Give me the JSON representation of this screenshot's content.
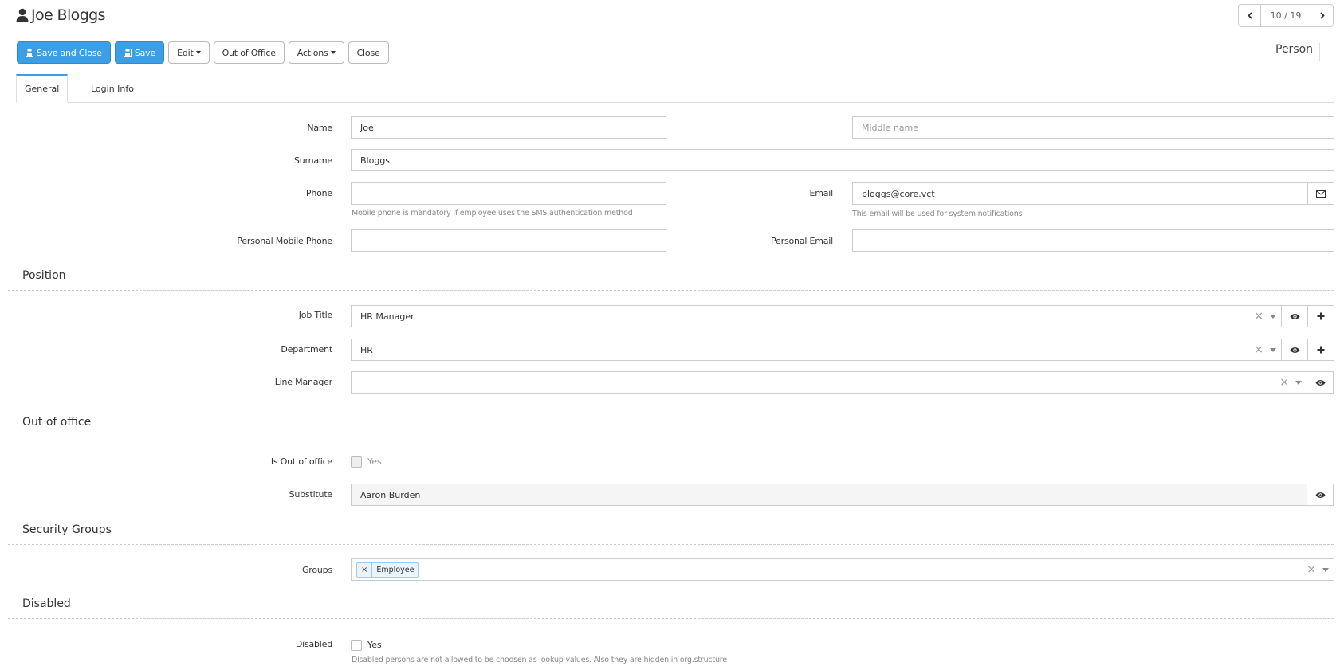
{
  "header": {
    "title": "Joe Bloggs",
    "pager": "10 / 19",
    "entity_type": "Person"
  },
  "toolbar": {
    "save_close": "Save and Close",
    "save": "Save",
    "edit": "Edit",
    "out_of_office": "Out of Office",
    "actions": "Actions",
    "close": "Close"
  },
  "tabs": {
    "general": "General",
    "login_info": "Login Info"
  },
  "form": {
    "name_label": "Name",
    "name_value": "Joe",
    "middle_placeholder": "Middle name",
    "surname_label": "Surname",
    "surname_value": "Bloggs",
    "phone_label": "Phone",
    "phone_value": "",
    "phone_help": "Mobile phone is mandatory if employee uses the SMS authentication method",
    "email_label": "Email",
    "email_value": "bloggs@core.vct",
    "email_help": "This email will be used for system notifications",
    "pmobile_label": "Personal Mobile Phone",
    "pmobile_value": "",
    "pemail_label": "Personal Email",
    "pemail_value": ""
  },
  "position": {
    "section": "Position",
    "job_title_label": "Job Title",
    "job_title_value": "HR Manager",
    "department_label": "Department",
    "department_value": "HR",
    "line_manager_label": "Line Manager",
    "line_manager_value": ""
  },
  "out_of_office": {
    "section": "Out of office",
    "is_ooo_label": "Is Out of office",
    "is_ooo_option": "Yes",
    "substitute_label": "Substitute",
    "substitute_value": "Aaron Burden"
  },
  "security": {
    "section": "Security Groups",
    "groups_label": "Groups",
    "tag_remove": "×",
    "groups": [
      "Employee"
    ]
  },
  "disabled": {
    "section": "Disabled",
    "label": "Disabled",
    "option": "Yes",
    "help": "Disabled persons are not allowed to be choosen as lookup values. Also they are hidden in org.structure"
  },
  "icons": {
    "user": "user-icon",
    "prev": "chevron-left-icon",
    "next": "chevron-right-icon",
    "save": "floppy-disk-icon",
    "envelope": "envelope-icon",
    "eye": "eye-icon",
    "plus": "plus-icon"
  },
  "colors": {
    "primary": "#3c9fe6",
    "tab_accent": "#3c9fe6",
    "tag_bg": "#eaf4fc"
  }
}
